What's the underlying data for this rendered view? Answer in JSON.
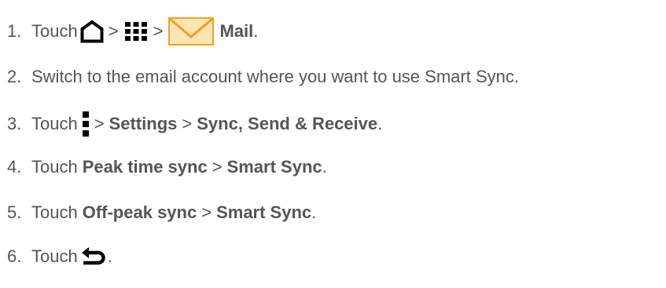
{
  "steps": [
    {
      "number": "1.",
      "parts": {
        "touch": "Touch",
        "sep1": ">",
        "sep2": ">",
        "mail": "Mail",
        "end": "."
      },
      "icons": [
        "home-icon",
        "apps-grid-icon",
        "mail-envelope-icon"
      ]
    },
    {
      "number": "2.",
      "text": "Switch to the email account where you want to use Smart Sync."
    },
    {
      "number": "3.",
      "parts": {
        "touch": "Touch",
        "sep1": ">",
        "settings": "Settings",
        "sep2": ">",
        "sync": "Sync, Send & Receive",
        "end": "."
      },
      "icons": [
        "menu-icon"
      ]
    },
    {
      "number": "4.",
      "parts": {
        "touch": "Touch",
        "peak": "Peak time sync",
        "sep": ">",
        "smart": "Smart Sync",
        "end": "."
      }
    },
    {
      "number": "5.",
      "parts": {
        "touch": "Touch",
        "offpeak": "Off-peak sync",
        "sep": ">",
        "smart": "Smart Sync",
        "end": "."
      }
    },
    {
      "number": "6.",
      "parts": {
        "touch": "Touch",
        "end": "."
      },
      "icons": [
        "back-icon"
      ]
    }
  ],
  "colors": {
    "text": "#555555",
    "icon": "#000000",
    "mail_fill": "#fde6b4",
    "mail_stroke": "#f0a01e"
  }
}
